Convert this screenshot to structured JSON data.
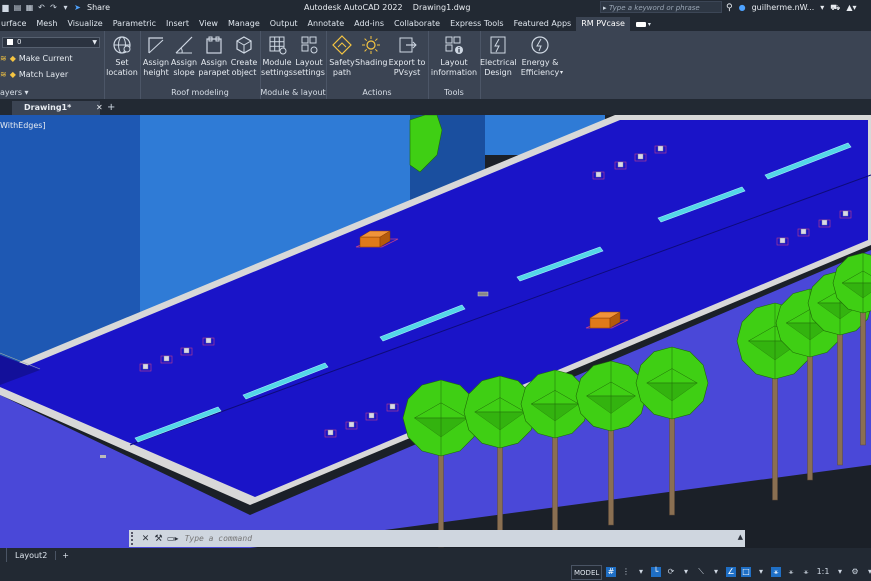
{
  "titlebar": {
    "share_label": "Share",
    "app_title": "Autodesk AutoCAD 2022",
    "file_name": "Drawing1.dwg",
    "search_placeholder": "Type a keyword or phrase",
    "user_name": "guilherme.nW...",
    "icons": [
      "qa-save-icon",
      "qa-saveas-icon",
      "qa-print-icon",
      "undo-icon",
      "redo-icon",
      "share-icon",
      "search-icon",
      "user-icon",
      "cart-icon",
      "triangle-icon"
    ]
  },
  "ribbon_tabs": [
    "urface",
    "Mesh",
    "Visualize",
    "Parametric",
    "Insert",
    "View",
    "Manage",
    "Output",
    "Annotate",
    "Add-ins",
    "Collaborate",
    "Express Tools",
    "Featured Apps",
    "RM PVcase"
  ],
  "active_tab": "RM PVcase",
  "ribbon": {
    "layers": {
      "current_layer": "0",
      "make_current": "Make Current",
      "match_layer": "Match Layer",
      "group_label": "ayers"
    },
    "set_location": {
      "line1": "Set",
      "line2": "location"
    },
    "roof_modeling": {
      "group_label": "Roof modeling",
      "buttons": [
        {
          "line1": "Assign",
          "line2": "height"
        },
        {
          "line1": "Assign",
          "line2": "slope"
        },
        {
          "line1": "Assign",
          "line2": "parapet"
        },
        {
          "line1": "Create",
          "line2": "object"
        }
      ]
    },
    "module_layout": {
      "group_label": "Module & layout",
      "buttons": [
        {
          "line1": "Module",
          "line2": "settings"
        },
        {
          "line1": "Layout",
          "line2": "settings"
        }
      ]
    },
    "actions": {
      "group_label": "Actions",
      "buttons": [
        {
          "line1": "Safety",
          "line2": "path"
        },
        {
          "line1": "Shading",
          "line2": ""
        },
        {
          "line1": "Export to",
          "line2": "PVsyst"
        }
      ]
    },
    "tools": {
      "group_label": "Tools",
      "buttons": [
        {
          "line1": "Layout",
          "line2": "information"
        }
      ]
    },
    "design": {
      "buttons": [
        {
          "line1": "Electrical",
          "line2": "Design"
        },
        {
          "line1": "Energy &",
          "line2": "Efficiency"
        }
      ]
    }
  },
  "file_tabs": {
    "active": "Drawing1*",
    "close": "✕",
    "new": "+"
  },
  "viewport": {
    "label": "WithEdges]",
    "colors": {
      "roof": "#1a14c8",
      "parapet": "#d8d8d8",
      "wall_side": "#4a48d8",
      "building_bg": "#1e63c4",
      "sky_block": "#2f7bd6",
      "panel": "#54d7e8",
      "unit": "#e07a1a",
      "tree": "#3fcf14",
      "trunk": "#8a6f52",
      "ground": "#1b2028"
    }
  },
  "command_line": {
    "placeholder": "Type a command",
    "close": "✕",
    "wrench": "🔧"
  },
  "layout_tabs": [
    "Layout2",
    "+"
  ],
  "status_bar": {
    "model": "MODEL",
    "scale": "1:1"
  }
}
